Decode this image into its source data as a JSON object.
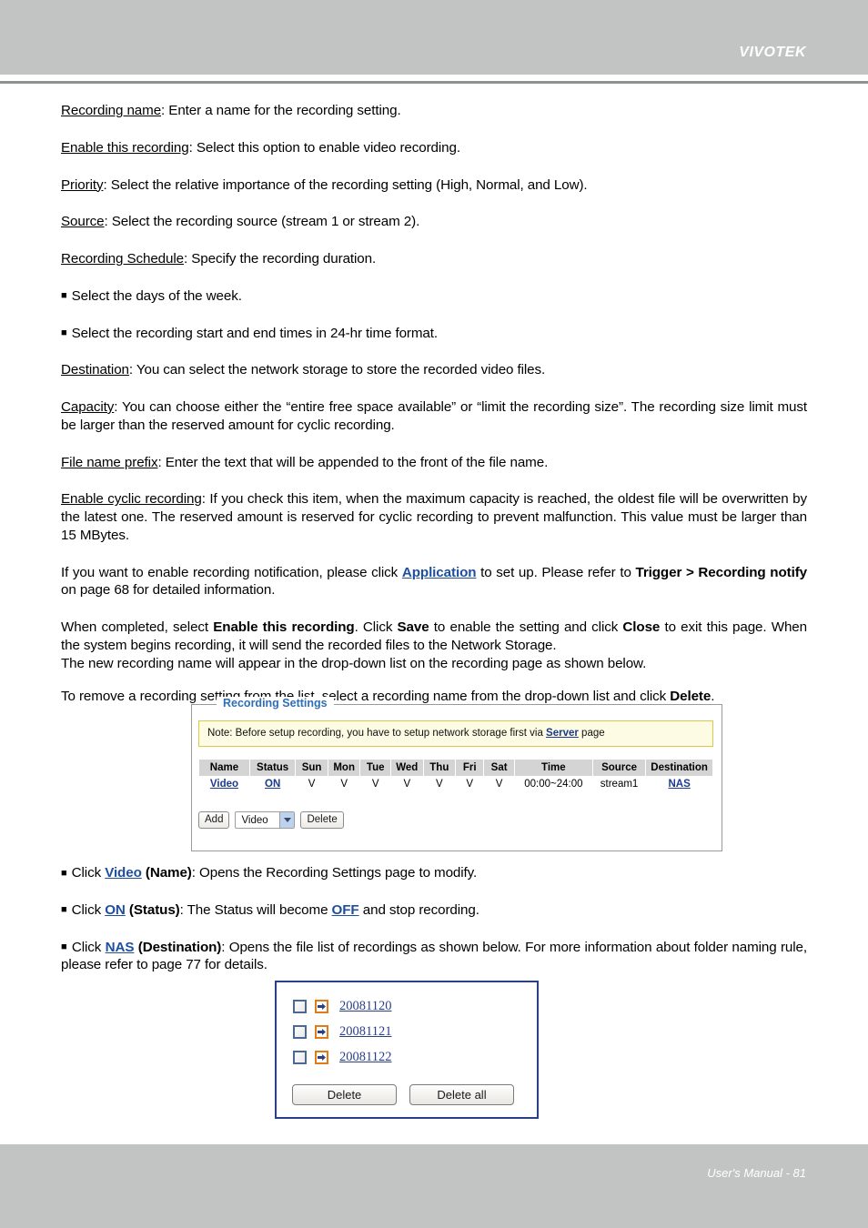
{
  "header": {
    "brand": "VIVOTEK"
  },
  "footer": {
    "text": "User's Manual - 81"
  },
  "body_paragraphs": {
    "recording_name": {
      "term": "Recording name",
      "rest": ": Enter a name for the recording setting."
    },
    "enable_this_recording": {
      "term": "Enable this recording",
      "rest": ": Select this option to enable video recording."
    },
    "priority": {
      "term": "Priority",
      "rest": ": Select the relative importance of the recording setting (High, Normal, and Low)."
    },
    "source": {
      "term": "Source",
      "rest": ": Select the recording source (stream 1 or stream 2)."
    },
    "recording_schedule": {
      "term": "Recording Schedule",
      "rest": ": Specify the recording duration."
    },
    "bullet_days": "Select the days of the week.",
    "bullet_times": "Select the recording start and end times in 24-hr time format.",
    "destination": {
      "term": "Destination",
      "rest": ": You can select the network storage to store the recorded video files."
    },
    "capacity": {
      "term": "Capacity",
      "rest": ": You can choose either the “entire free space available” or “limit the recording size”. The recording size limit must be larger than the reserved amount for cyclic recording."
    },
    "file_name_prefix": {
      "term": "File name prefix",
      "rest": ": Enter the text that will be appended to the front of the file name."
    },
    "enable_cyclic_recording": {
      "term": "Enable cyclic recording",
      "rest": ": If you check this item, when the maximum capacity is reached, the oldest file will be overwritten by the latest one. The reserved amount is reserved for cyclic recording to prevent malfunction. This value must be larger than 15 MBytes."
    },
    "notification": {
      "part1": "If you want to enable recording notification, please click ",
      "link": "Application",
      "part2": " to set up. Please refer to ",
      "bold1": "Trigger > Recording notify",
      "part3": " on page 68 for detailed information."
    },
    "completed": {
      "part1": "When completed, select ",
      "bold1": "Enable this recording",
      "part2": ". Click ",
      "bold2": "Save",
      "part3": " to enable the setting and click ",
      "bold3": "Close",
      "part4": " to exit this page. When the system begins recording, it will send the recorded files to the Network Storage.",
      "line3": "The new recording name will appear in the drop-down list on the recording page as shown below."
    },
    "remove": {
      "part1": "To remove a recording setting from the list, select a recording name from the drop-down list and click ",
      "bold1": "Delete",
      "part2": "."
    },
    "bullet_video": {
      "prefix": "Click ",
      "link": "Video",
      "bold": " (Name)",
      "rest": ": Opens the Recording Settings page to modify."
    },
    "bullet_on": {
      "prefix": "Click ",
      "link": "ON",
      "bold": " (Status)",
      "mid": ": The Status will become ",
      "link2": "OFF",
      "rest": " and stop recording."
    },
    "bullet_nas": {
      "prefix": "Click ",
      "link": "NAS",
      "bold": " (Destination)",
      "rest": ": Opens the file list of recordings as shown below. For more information about folder naming rule, please refer to page 77 for details."
    }
  },
  "recording_settings_panel": {
    "legend": "Recording Settings",
    "note": {
      "part1": "Note: Before setup recording, you have to setup network storage first via ",
      "link": "Server",
      "part2": " page"
    },
    "table": {
      "headers": [
        "Name",
        "Status",
        "Sun",
        "Mon",
        "Tue",
        "Wed",
        "Thu",
        "Fri",
        "Sat",
        "Time",
        "Source",
        "Destination"
      ],
      "rows": [
        {
          "name": "Video",
          "status": "ON",
          "sun": "V",
          "mon": "V",
          "tue": "V",
          "wed": "V",
          "thu": "V",
          "fri": "V",
          "sat": "V",
          "time": "00:00~24:00",
          "source": "stream1",
          "destination": "NAS"
        }
      ]
    },
    "controls": {
      "add_label": "Add",
      "select_value": "Video",
      "delete_label": "Delete"
    }
  },
  "file_list_dialog": {
    "items": [
      {
        "name": "20081120"
      },
      {
        "name": "20081121"
      },
      {
        "name": "20081122"
      }
    ],
    "delete_label": "Delete",
    "delete_all_label": "Delete all"
  },
  "colors": {
    "header_bar": "#c2c4c4",
    "header_rule": "#8e9192",
    "link_blue": "#1f4e9c",
    "legend_blue": "#2f6fb5",
    "note_bg": "#fdfbe3",
    "note_border": "#d9c84a",
    "table_header_bg": "#d4d4d4",
    "dialog_border": "#2a3f86",
    "arrow_orange": "#e07b18"
  }
}
